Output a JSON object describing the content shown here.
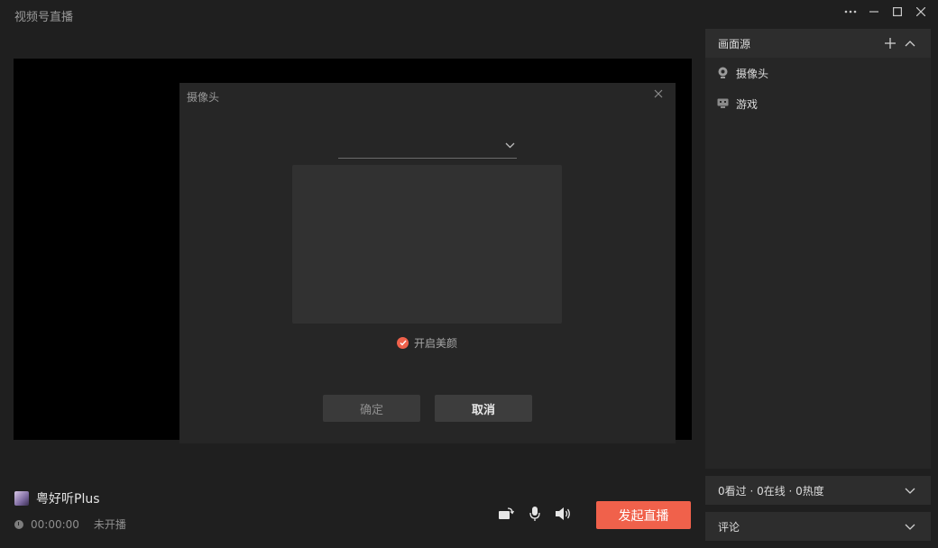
{
  "app": {
    "title": "视频号直播"
  },
  "window": {
    "icons": [
      "more-icon",
      "minimize-icon",
      "maximize-icon",
      "close-icon"
    ]
  },
  "dialog": {
    "title": "摄像头",
    "camera_select": {
      "value": ""
    },
    "beauty": {
      "label": "开启美颜",
      "checked": true
    },
    "ok_label": "确定",
    "cancel_label": "取消"
  },
  "sources": {
    "title": "画面源",
    "items": [
      {
        "label": "摄像头",
        "icon": "webcam-icon"
      },
      {
        "label": "游戏",
        "icon": "game-icon"
      }
    ]
  },
  "stats": {
    "text": "0看过 · 0在线 · 0热度"
  },
  "comments": {
    "label": "评论"
  },
  "user": {
    "name": "粤好听Plus"
  },
  "timer": {
    "time": "00:00:00",
    "status": "未开播"
  },
  "controls": {
    "icons": [
      "rotate-camera-icon",
      "microphone-icon",
      "speaker-icon"
    ],
    "go_live_label": "发起直播"
  },
  "colors": {
    "accent": "#f0614b",
    "background": "#1f1f1f",
    "panel": "#262626"
  }
}
